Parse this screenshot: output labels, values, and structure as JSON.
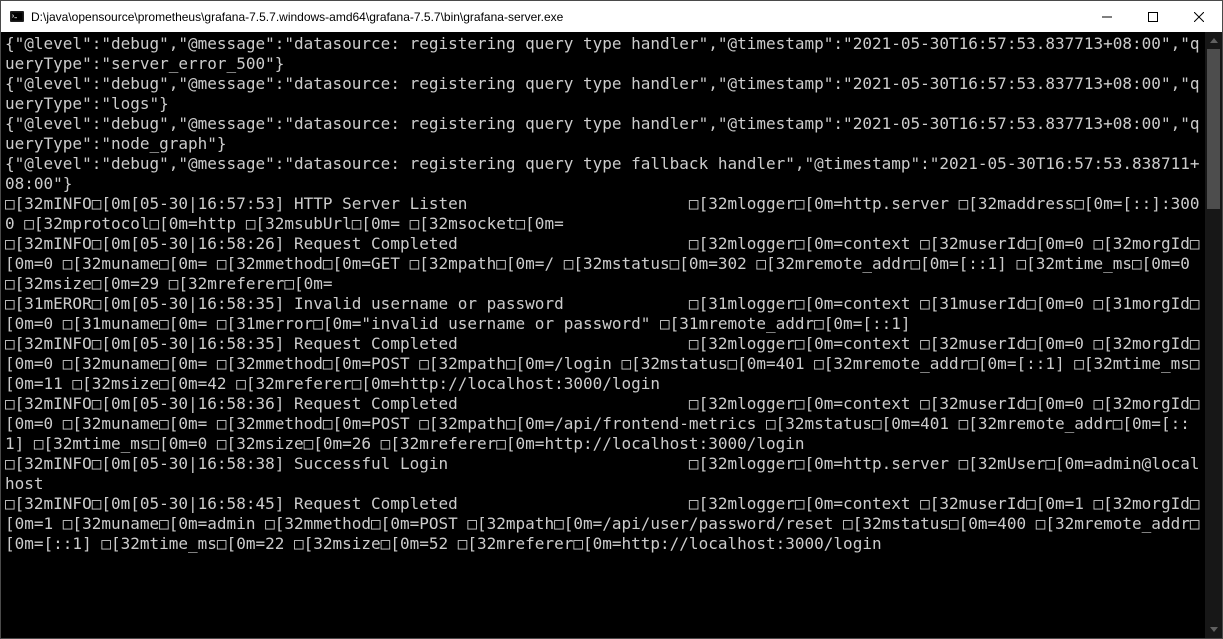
{
  "window": {
    "title": "D:\\java\\opensource\\prometheus\\grafana-7.5.7.windows-amd64\\grafana-7.5.7\\bin\\grafana-server.exe"
  },
  "console": {
    "lines": [
      "{\"@level\":\"debug\",\"@message\":\"datasource: registering query type handler\",\"@timestamp\":\"2021-05-30T16:57:53.837713+08:00\",\"queryType\":\"server_error_500\"}",
      "{\"@level\":\"debug\",\"@message\":\"datasource: registering query type handler\",\"@timestamp\":\"2021-05-30T16:57:53.837713+08:00\",\"queryType\":\"logs\"}",
      "{\"@level\":\"debug\",\"@message\":\"datasource: registering query type handler\",\"@timestamp\":\"2021-05-30T16:57:53.837713+08:00\",\"queryType\":\"node_graph\"}",
      "{\"@level\":\"debug\",\"@message\":\"datasource: registering query type fallback handler\",\"@timestamp\":\"2021-05-30T16:57:53.838711+08:00\"}",
      "□[32mINFO□[0m[05-30|16:57:53] HTTP Server Listen                       □[32mlogger□[0m=http.server □[32maddress□[0m=[::]:3000 □[32mprotocol□[0m=http □[32msubUrl□[0m= □[32msocket□[0m=",
      "□[32mINFO□[0m[05-30|16:58:26] Request Completed                        □[32mlogger□[0m=context □[32muserId□[0m=0 □[32morgId□[0m=0 □[32muname□[0m= □[32mmethod□[0m=GET □[32mpath□[0m=/ □[32mstatus□[0m=302 □[32mremote_addr□[0m=[::1] □[32mtime_ms□[0m=0 □[32msize□[0m=29 □[32mreferer□[0m=",
      "□[31mEROR□[0m[05-30|16:58:35] Invalid username or password             □[31mlogger□[0m=context □[31muserId□[0m=0 □[31morgId□[0m=0 □[31muname□[0m= □[31merror□[0m=\"invalid username or password\" □[31mremote_addr□[0m=[::1]",
      "□[32mINFO□[0m[05-30|16:58:35] Request Completed                        □[32mlogger□[0m=context □[32muserId□[0m=0 □[32morgId□[0m=0 □[32muname□[0m= □[32mmethod□[0m=POST □[32mpath□[0m=/login □[32mstatus□[0m=401 □[32mremote_addr□[0m=[::1] □[32mtime_ms□[0m=11 □[32msize□[0m=42 □[32mreferer□[0m=http://localhost:3000/login",
      "□[32mINFO□[0m[05-30|16:58:36] Request Completed                        □[32mlogger□[0m=context □[32muserId□[0m=0 □[32morgId□[0m=0 □[32muname□[0m= □[32mmethod□[0m=POST □[32mpath□[0m=/api/frontend-metrics □[32mstatus□[0m=401 □[32mremote_addr□[0m=[::1] □[32mtime_ms□[0m=0 □[32msize□[0m=26 □[32mreferer□[0m=http://localhost:3000/login",
      "□[32mINFO□[0m[05-30|16:58:38] Successful Login                         □[32mlogger□[0m=http.server □[32mUser□[0m=admin@localhost",
      "□[32mINFO□[0m[05-30|16:58:45] Request Completed                        □[32mlogger□[0m=context □[32muserId□[0m=1 □[32morgId□[0m=1 □[32muname□[0m=admin □[32mmethod□[0m=POST □[32mpath□[0m=/api/user/password/reset □[32mstatus□[0m=400 □[32mremote_addr□[0m=[::1] □[32mtime_ms□[0m=22 □[32msize□[0m=52 □[32mreferer□[0m=http://localhost:3000/login"
    ]
  }
}
